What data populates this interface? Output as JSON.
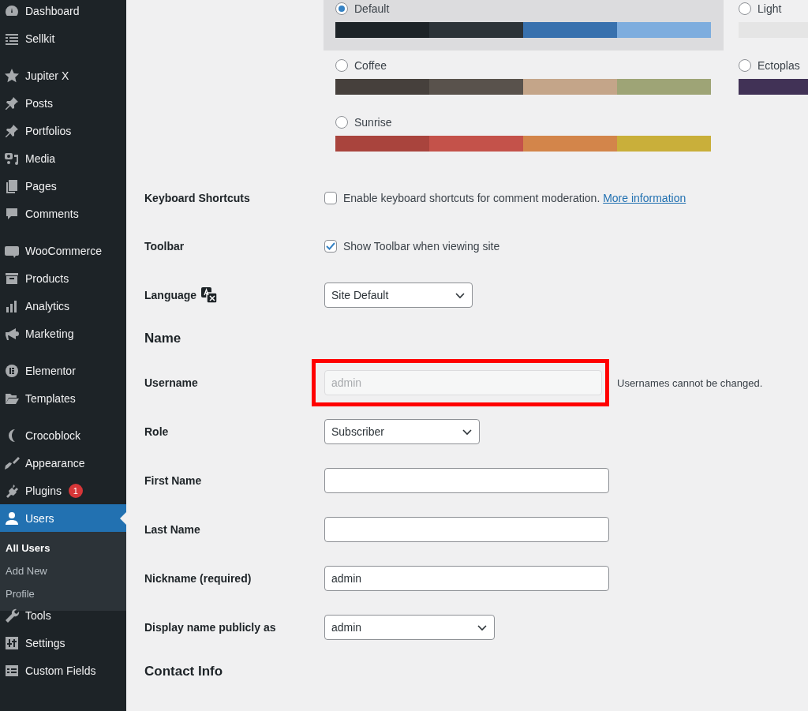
{
  "sidebar": {
    "groups": [
      {
        "items": [
          {
            "label": "Dashboard",
            "selected": false
          },
          {
            "label": "Sellkit",
            "selected": false
          }
        ]
      },
      {
        "items": [
          {
            "label": "Jupiter X",
            "selected": false
          },
          {
            "label": "Posts",
            "selected": false
          },
          {
            "label": "Portfolios",
            "selected": false
          },
          {
            "label": "Media",
            "selected": false
          },
          {
            "label": "Pages",
            "selected": false
          },
          {
            "label": "Comments",
            "selected": false
          }
        ]
      },
      {
        "items": [
          {
            "label": "WooCommerce",
            "selected": false
          },
          {
            "label": "Products",
            "selected": false
          },
          {
            "label": "Analytics",
            "selected": false
          },
          {
            "label": "Marketing",
            "selected": false
          }
        ]
      },
      {
        "items": [
          {
            "label": "Elementor",
            "selected": false
          },
          {
            "label": "Templates",
            "selected": false
          }
        ]
      },
      {
        "items": [
          {
            "label": "Crocoblock",
            "selected": false
          },
          {
            "label": "Appearance",
            "selected": false
          },
          {
            "label": "Plugins",
            "selected": false,
            "badge": "1"
          },
          {
            "label": "Users",
            "selected": true,
            "children": [
              {
                "label": "All Users",
                "selected": true
              },
              {
                "label": "Add New",
                "selected": false
              },
              {
                "label": "Profile",
                "selected": false
              }
            ]
          },
          {
            "label": "Tools",
            "selected": false
          },
          {
            "label": "Settings",
            "selected": false
          },
          {
            "label": "Custom Fields",
            "selected": false
          }
        ]
      }
    ]
  },
  "color_schemes": [
    {
      "label": "Default",
      "selected": true,
      "swatches": [
        {
          "color": "#1d2327"
        },
        {
          "color": "#2c3338"
        },
        {
          "color": "#3871ae"
        },
        {
          "color": "#7eadde"
        }
      ]
    },
    {
      "label": "Light",
      "selected": false,
      "swatches": [
        {
          "color": "#e5e5e5"
        }
      ]
    },
    {
      "label": "Coffee",
      "selected": false,
      "swatches": [
        {
          "color": "#46403c"
        },
        {
          "color": "#59524c"
        },
        {
          "color": "#c4a589"
        },
        {
          "color": "#9ea476"
        }
      ]
    },
    {
      "label": "Ectoplas",
      "selected": false,
      "swatches": [
        {
          "color": "#413256"
        }
      ]
    },
    {
      "label": "Sunrise",
      "selected": false,
      "swatches": [
        {
          "color": "#a9443d"
        },
        {
          "color": "#c4524a"
        },
        {
          "color": "#d3854a"
        },
        {
          "color": "#c9af3a"
        }
      ]
    }
  ],
  "rows": [
    {
      "kind": "checkbox",
      "label": "Keyboard Shortcuts",
      "checked": false,
      "text": "Enable keyboard shortcuts for comment moderation.",
      "link": "More information"
    },
    {
      "kind": "checkbox",
      "label": "Toolbar",
      "checked": true,
      "text": "Show Toolbar when viewing site"
    },
    {
      "kind": "select",
      "label": "Language",
      "value": "Site Default",
      "language_icon": true
    },
    {
      "kind": "heading",
      "label": "Name"
    },
    {
      "kind": "input",
      "label": "Username",
      "value": "admin",
      "disabled": true,
      "highlighted": true,
      "note": "Usernames cannot be changed."
    },
    {
      "kind": "select",
      "label": "Role",
      "value": "Subscriber"
    },
    {
      "kind": "input",
      "label": "First Name",
      "disabled": false
    },
    {
      "kind": "input",
      "label": "Last Name",
      "disabled": false
    },
    {
      "kind": "input",
      "label": "Nickname (required)",
      "value": "admin",
      "disabled": false
    },
    {
      "kind": "select",
      "label": "Display name publicly as",
      "value": "admin"
    },
    {
      "kind": "heading",
      "label": "Contact Info"
    }
  ]
}
